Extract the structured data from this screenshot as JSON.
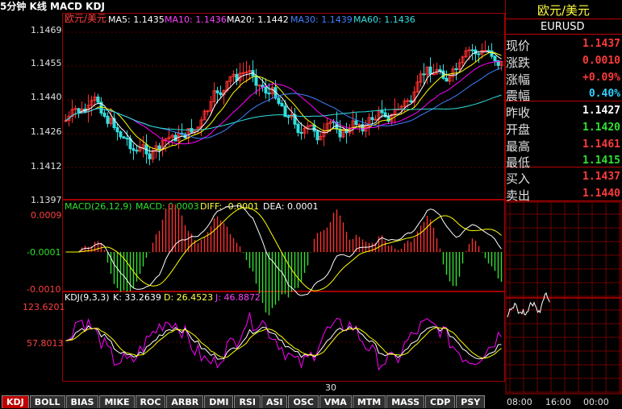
{
  "header": {
    "period": "5分钟 K线 MACD KDJ",
    "symbol_label": "欧元/美元",
    "ma5": "MA5: 1.1435",
    "ma10": "MA10: 1.1436",
    "ma20": "MA20: 1.1442",
    "ma30": "MA30: 1.1439",
    "ma60": "MA60: 1.1436"
  },
  "price_axis": [
    "1.1469",
    "1.1455",
    "1.1440",
    "1.1426",
    "1.1412",
    "1.1397"
  ],
  "macd": {
    "title": "MACD(26,12,9)",
    "macd": "MACD: 0.0003",
    "diff": "DIFF: -0.0001",
    "dea": "DEA: 0.0001",
    "axis": [
      "0.0009",
      "-0.0001",
      "-0.0010"
    ]
  },
  "kdj": {
    "title": "KDJ(9,3,3)",
    "k": "K: 33.2639",
    "d": "D: 26.4523",
    "j": "J: 46.8872",
    "axis": [
      "123.6201",
      "57.8013"
    ]
  },
  "x_marker": "30",
  "quote": {
    "name": "欧元/美元",
    "code": "EURUSD",
    "rows": [
      {
        "label": "现价",
        "value": "1.1437",
        "color": "#ff3b3b"
      },
      {
        "label": "涨跌",
        "value": "0.0010",
        "color": "#ff3b3b"
      },
      {
        "label": "涨幅",
        "value": "+0.09%",
        "color": "#ff3b3b"
      },
      {
        "label": "震幅",
        "value": "0.40%",
        "color": "#30d0ff"
      },
      {
        "label": "昨收",
        "value": "1.1427",
        "color": "#ffffff"
      },
      {
        "label": "开盘",
        "value": "1.1420",
        "color": "#30e030"
      },
      {
        "label": "最高",
        "value": "1.1461",
        "color": "#ff3b3b"
      },
      {
        "label": "最低",
        "value": "1.1415",
        "color": "#30e030"
      },
      {
        "label": "买入",
        "value": "1.1437",
        "color": "#ff3b3b"
      },
      {
        "label": "卖出",
        "value": "1.1440",
        "color": "#ff3b3b"
      }
    ]
  },
  "mini_axis": [
    "08:00",
    "16:00",
    "00:00"
  ],
  "tabs": [
    "KDJ",
    "BOLL",
    "BIAS",
    "MIKE",
    "ROC",
    "ARBR",
    "DMI",
    "RSI",
    "ASI",
    "OSC",
    "VMA",
    "MTM",
    "MASS",
    "CDP",
    "PSY"
  ],
  "active_tab": "KDJ",
  "colors": {
    "up": "#ff3030",
    "down": "#30e0e0",
    "ma5": "#ffffff",
    "ma10": "#ffff00",
    "ma20": "#ff00ff",
    "ma30": "#00c000",
    "ma60": "#4080ff",
    "grid": "#800000"
  }
}
